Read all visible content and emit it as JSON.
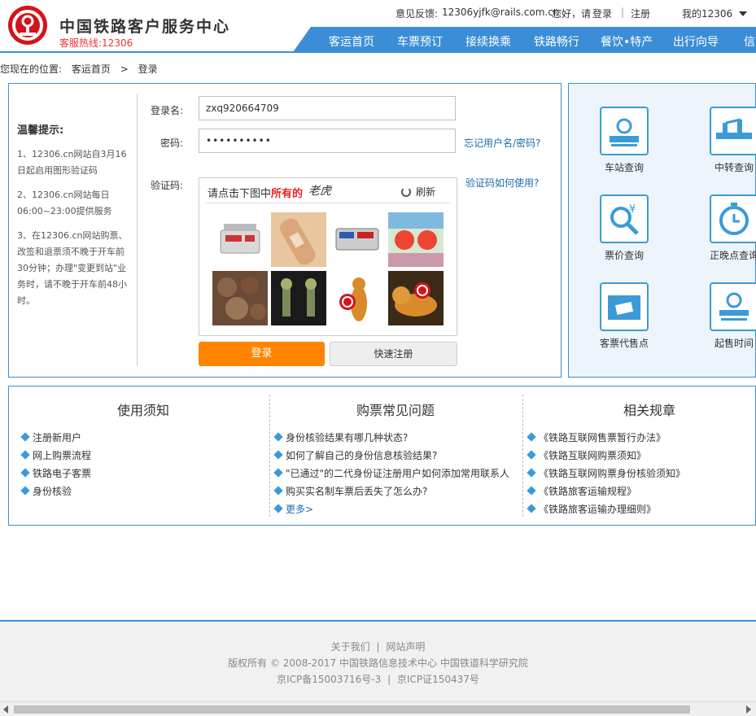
{
  "header": {
    "brand": "中国铁路客户服务中心",
    "hotline": "客服热线:12306",
    "feedback_label": "意见反馈:",
    "feedback_email": "12306yjfk@rails.com.cn",
    "greeting": "您好，请",
    "login": "登录",
    "separator": "|",
    "register": "注册",
    "my12306": "我的12306",
    "nav": [
      "客运首页",
      "车票预订",
      "接续换乘",
      "铁路畅行",
      "餐饮•特产",
      "出行向导",
      "信"
    ]
  },
  "breadcrumb": {
    "prefix": "您现在的位置:",
    "home": "客运首页",
    "sep": ">",
    "current": "登录"
  },
  "tips": {
    "title": "温馨提示:",
    "items": [
      "1、12306.cn网站自3月16日起启用图形验证码",
      "2、12306.cn网站每日06:00~23:00提供服务",
      "3、在12306.cn网站购票、改签和退票须不晚于开车前30分钟；办理\"变更到站\"业务时，请不晚于开车前48小时。"
    ]
  },
  "form": {
    "username_label": "登录名:",
    "username_value": "zxq920664709",
    "password_label": "密码:",
    "password_value": "••••••••••",
    "forgot": "忘记用户名/密码?",
    "captcha_label": "验证码:",
    "captcha_help": "验证码如何使用?",
    "captcha_prompt_pre": "请点击下图中",
    "captcha_prompt_em": "所有的",
    "captcha_word": "老虎",
    "refresh": "刷新",
    "login_button": "登录",
    "quick_register": "快速注册"
  },
  "quick": [
    {
      "label": "车站查询",
      "icon": "station-icon"
    },
    {
      "label": "中转查询",
      "icon": "transfer-icon"
    },
    {
      "label": "票价查询",
      "icon": "price-search-icon"
    },
    {
      "label": "正晚点查询",
      "icon": "clock-icon"
    },
    {
      "label": "客票代售点",
      "icon": "ticket-agency-icon"
    },
    {
      "label": "起售时间",
      "icon": "sale-time-icon"
    }
  ],
  "info": {
    "col1": {
      "title": "使用须知",
      "items": [
        "注册新用户",
        "网上购票流程",
        "铁路电子客票",
        "身份核验"
      ]
    },
    "col2": {
      "title": "购票常见问题",
      "items": [
        "身份核验结果有哪几种状态?",
        "如何了解自己的身份信息核验结果?",
        "\"已通过\"的二代身份证注册用户如何添加常用联系人",
        "购买实名制车票后丢失了怎么办?"
      ],
      "more": "更多>"
    },
    "col3": {
      "title": "相关规章",
      "items": [
        "《铁路互联网售票暂行办法》",
        "《铁路互联网购票须知》",
        "《铁路互联网购票身份核验须知》",
        "《铁路旅客运输规程》",
        "《铁路旅客运输办理细则》"
      ]
    }
  },
  "footer": {
    "about": "关于我们",
    "sep": "|",
    "statement": "网站声明",
    "copyright": "版权所有 © 2008-2017 中国铁路信息技术中心 中国铁道科学研究院",
    "icp1": "京ICP备15003716号-3",
    "icp_sep": "|",
    "icp2": "京ICP证150437号"
  },
  "colors": {
    "accent": "#3b8ed6",
    "orange": "#ff8400",
    "brand_red": "#d4141b"
  }
}
